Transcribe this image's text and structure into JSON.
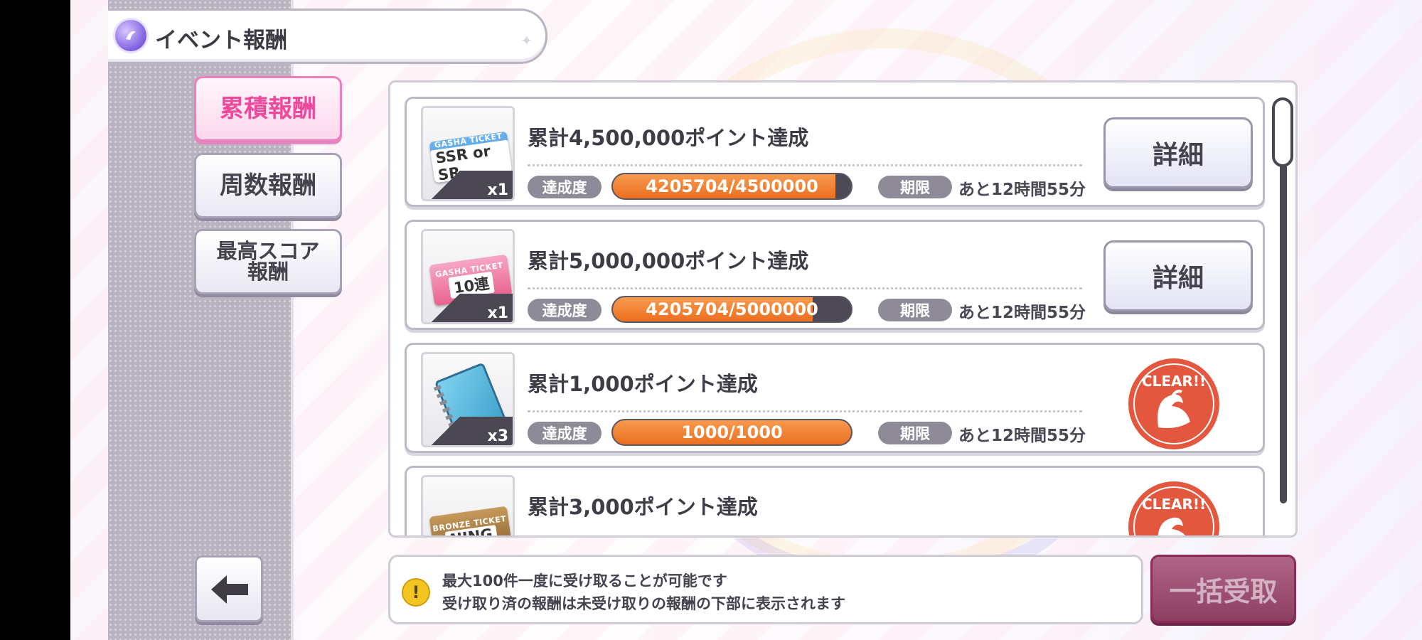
{
  "header": {
    "title": "イベント報酬"
  },
  "sidebar": {
    "tabs": [
      {
        "label": "累積報酬",
        "active": true
      },
      {
        "label": "周数報酬",
        "active": false
      },
      {
        "label": "最高スコア\n報酬",
        "active": false
      }
    ]
  },
  "rewards": [
    {
      "title": "累計4,500,000ポイント達成",
      "ticket_top": "GASHA TICKET",
      "ticket_main": "SSR or SR",
      "quantity": "x1",
      "progress_label": "達成度",
      "progress_text": "4205704/4500000",
      "progress_fraction": 0.9346,
      "deadline_label": "期限",
      "remaining": "あと12時間55分",
      "action": "詳細",
      "cleared": false
    },
    {
      "title": "累計5,000,000ポイント達成",
      "ticket_top": "GASHA TICKET",
      "ticket_main": "10連",
      "quantity": "x1",
      "progress_label": "達成度",
      "progress_text": "4205704/5000000",
      "progress_fraction": 0.8411,
      "deadline_label": "期限",
      "remaining": "あと12時間55分",
      "action": "詳細",
      "cleared": false
    },
    {
      "title": "累計1,000ポイント達成",
      "quantity": "x3",
      "progress_label": "達成度",
      "progress_text": "1000/1000",
      "progress_fraction": 1.0,
      "deadline_label": "期限",
      "remaining": "あと12時間55分",
      "stamp": "CLEAR!!",
      "cleared": true
    },
    {
      "title": "累計3,000ポイント達成",
      "ticket_top": "BRONZE TICKET",
      "ticket_main": "NING",
      "stamp": "CLEAR!!",
      "cleared": true
    }
  ],
  "notice": {
    "line1": "最大100件一度に受け取ることが可能です",
    "line2": "受け取り済の報酬は未受け取りの報酬の下部に表示されます"
  },
  "claim_all_label": "一括受取",
  "colors": {
    "accent_pink": "#ee4a9c",
    "progress_orange": "#ec6f1f",
    "clear_red": "#e4573f"
  }
}
